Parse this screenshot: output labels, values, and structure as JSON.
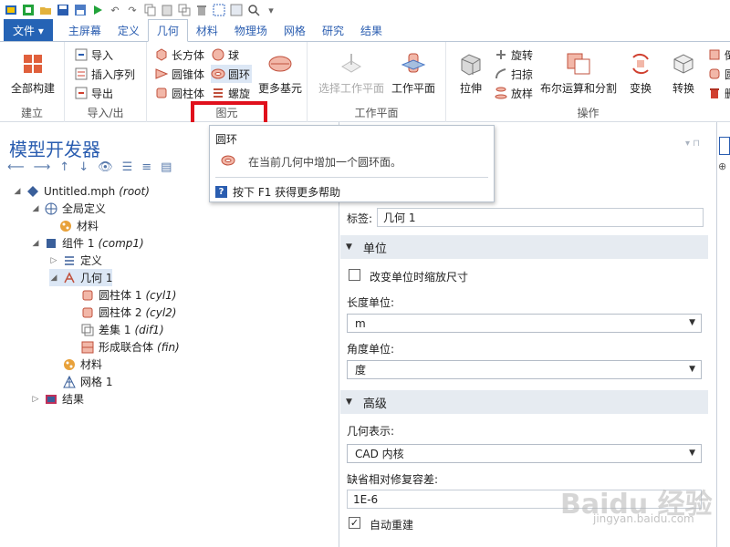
{
  "quick_access": {
    "icons": [
      "new-icon",
      "open-icon",
      "save-icon",
      "save-as-icon",
      "run-icon",
      "undo-icon",
      "redo-icon",
      "copy-icon",
      "paste-icon",
      "duplicate-icon",
      "delete-icon",
      "select-icon",
      "zoom-icon",
      "search-icon",
      "dropdown-icon"
    ]
  },
  "tabs": [
    "文件 ▾",
    "主屏幕",
    "定义",
    "几何",
    "材料",
    "物理场",
    "网格",
    "研究",
    "结果"
  ],
  "ribbon": {
    "build_all": "全部构建",
    "group_build": "建立",
    "import": "导入",
    "insert_sequence": "插入序列",
    "export": "导出",
    "group_import_export": "导入/出",
    "block": "长方体",
    "sphere": "球",
    "cone": "圆锥体",
    "torus": "圆环",
    "cylinder": "圆柱体",
    "helix": "螺旋",
    "more_primitives": "更多基元",
    "group_primitives": "图元",
    "select_work_plane": "选择工作平面",
    "work_plane": "工作平面",
    "group_work_plane": "工作平面",
    "extrude": "拉伸",
    "revolve": "旋转",
    "sweep": "扫掠",
    "loft": "放样",
    "booleans": "布尔运算和分割",
    "transforms": "变换",
    "conversions": "转换",
    "group_operations": "操作",
    "partial_1": "倒",
    "partial_2": "圆",
    "partial_3": "删"
  },
  "model_builder": {
    "title": "模型开发器",
    "tree": [
      {
        "label": "Untitled.mph",
        "tag": "(root)"
      },
      {
        "label": "全局定义",
        "tag": ""
      },
      {
        "label": "材料",
        "tag": ""
      },
      {
        "label": "组件 1",
        "tag": "(comp1)"
      },
      {
        "label": "定义",
        "tag": ""
      },
      {
        "label": "几何 1",
        "tag": ""
      },
      {
        "label": "圆柱体 1",
        "tag": "(cyl1)"
      },
      {
        "label": "圆柱体 2",
        "tag": "(cyl2)"
      },
      {
        "label": "差集 1",
        "tag": "(dif1)"
      },
      {
        "label": "形成联合体",
        "tag": "(fin)"
      },
      {
        "label": "材料",
        "tag": ""
      },
      {
        "label": "网格 1",
        "tag": ""
      },
      {
        "label": "结果",
        "tag": ""
      }
    ]
  },
  "tooltip": {
    "title": "圆环",
    "description": "在当前几何中增加一个圆环面。",
    "help_key": "?",
    "help_text": "按下 F1 获得更多帮助"
  },
  "settings": {
    "label_caption": "标签:",
    "label_value": "几何 1",
    "units_section": "单位",
    "scale_checkbox": "改变单位时缩放尺寸",
    "length_unit_caption": "长度单位:",
    "length_unit_value": "m",
    "angular_unit_caption": "角度单位:",
    "angular_unit_value": "度",
    "advanced_section": "高级",
    "geometry_rep_caption": "几何表示:",
    "geometry_rep_value": "CAD 内核",
    "tolerance_caption": "缺省相对修复容差:",
    "tolerance_value": "1E-6",
    "auto_rebuild": "自动重建",
    "auto_rebuild_checked": true
  },
  "watermark": {
    "main": "Baidu 经验",
    "sub": "jingyan.baidu.com"
  },
  "colors": {
    "accent": "#2563b5",
    "highlight": "#e0101c",
    "section_bg": "#e6ebf1"
  }
}
